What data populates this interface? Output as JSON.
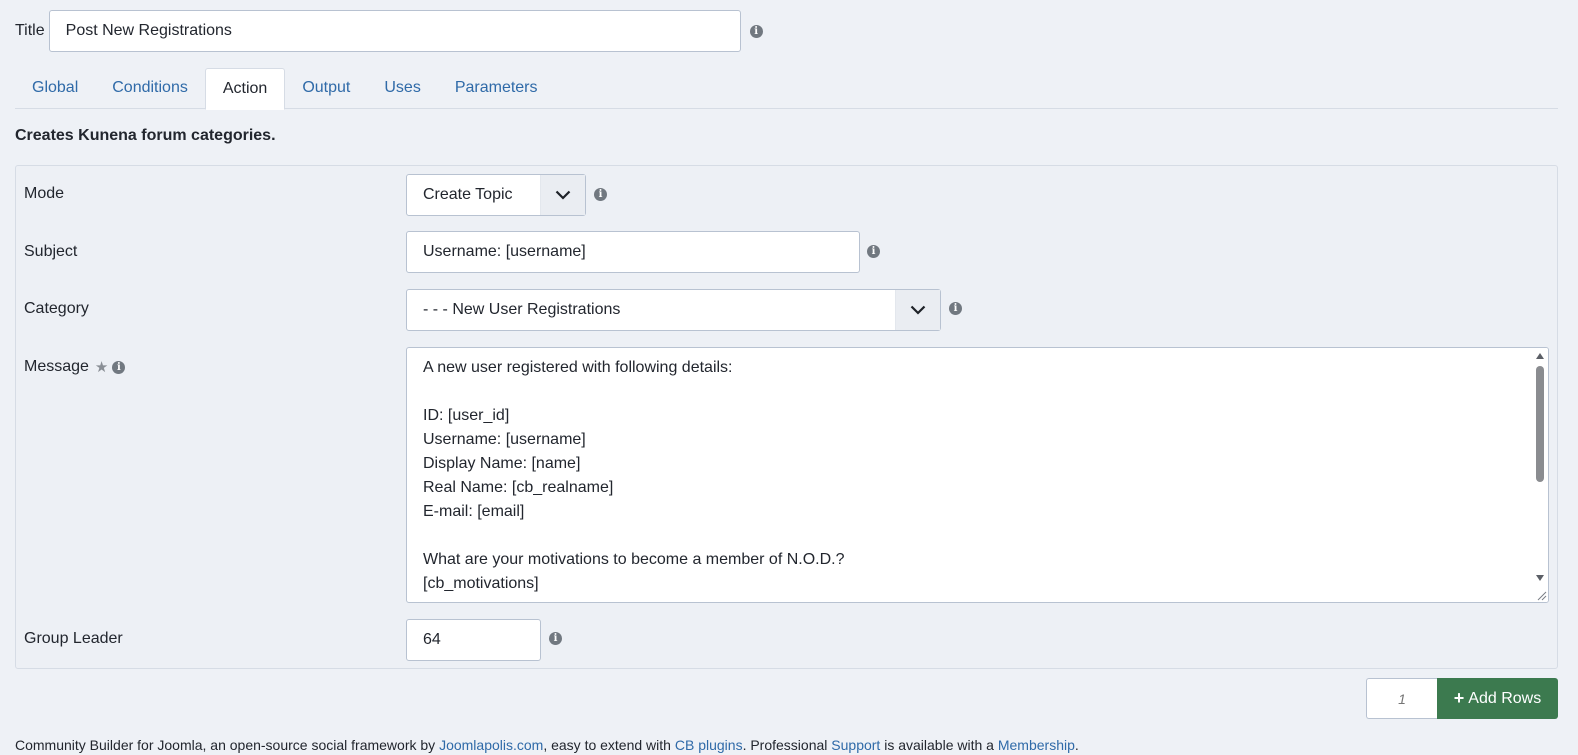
{
  "title": {
    "label": "Title",
    "value": "Post New Registrations"
  },
  "tabs": [
    {
      "label": "Global"
    },
    {
      "label": "Conditions"
    },
    {
      "label": "Action"
    },
    {
      "label": "Output"
    },
    {
      "label": "Uses"
    },
    {
      "label": "Parameters"
    }
  ],
  "active_tab": "Action",
  "description": "Creates Kunena forum categories.",
  "fields": {
    "mode": {
      "label": "Mode",
      "value": "Create Topic"
    },
    "subject": {
      "label": "Subject",
      "value": "Username: [username]"
    },
    "category": {
      "label": "Category",
      "value": "- - - New User Registrations"
    },
    "message": {
      "label": "Message",
      "value": "A new user registered with following details:\n\nID: [user_id]\nUsername: [username]\nDisplay Name: [name]\nReal Name: [cb_realname]\nE-mail: [email]\n\nWhat are your motivations to become a member of N.O.D.?\n[cb_motivations]"
    },
    "group_leader": {
      "label": "Group Leader",
      "value": "64"
    }
  },
  "add_rows": {
    "count_placeholder": "1",
    "button_label": "Add Rows"
  },
  "footer": {
    "text1": "Community Builder for Joomla, an open-source social framework by ",
    "link1": "Joomlapolis.com",
    "text2": ", easy to extend with ",
    "link2": "CB plugins",
    "text3": ". Professional ",
    "link3": "Support",
    "text4": " is available with a ",
    "link4": "Membership",
    "text5": "."
  },
  "colors": {
    "link": "#2f6aa8",
    "button_green": "#3c7a4f",
    "background": "#eef1f6"
  }
}
